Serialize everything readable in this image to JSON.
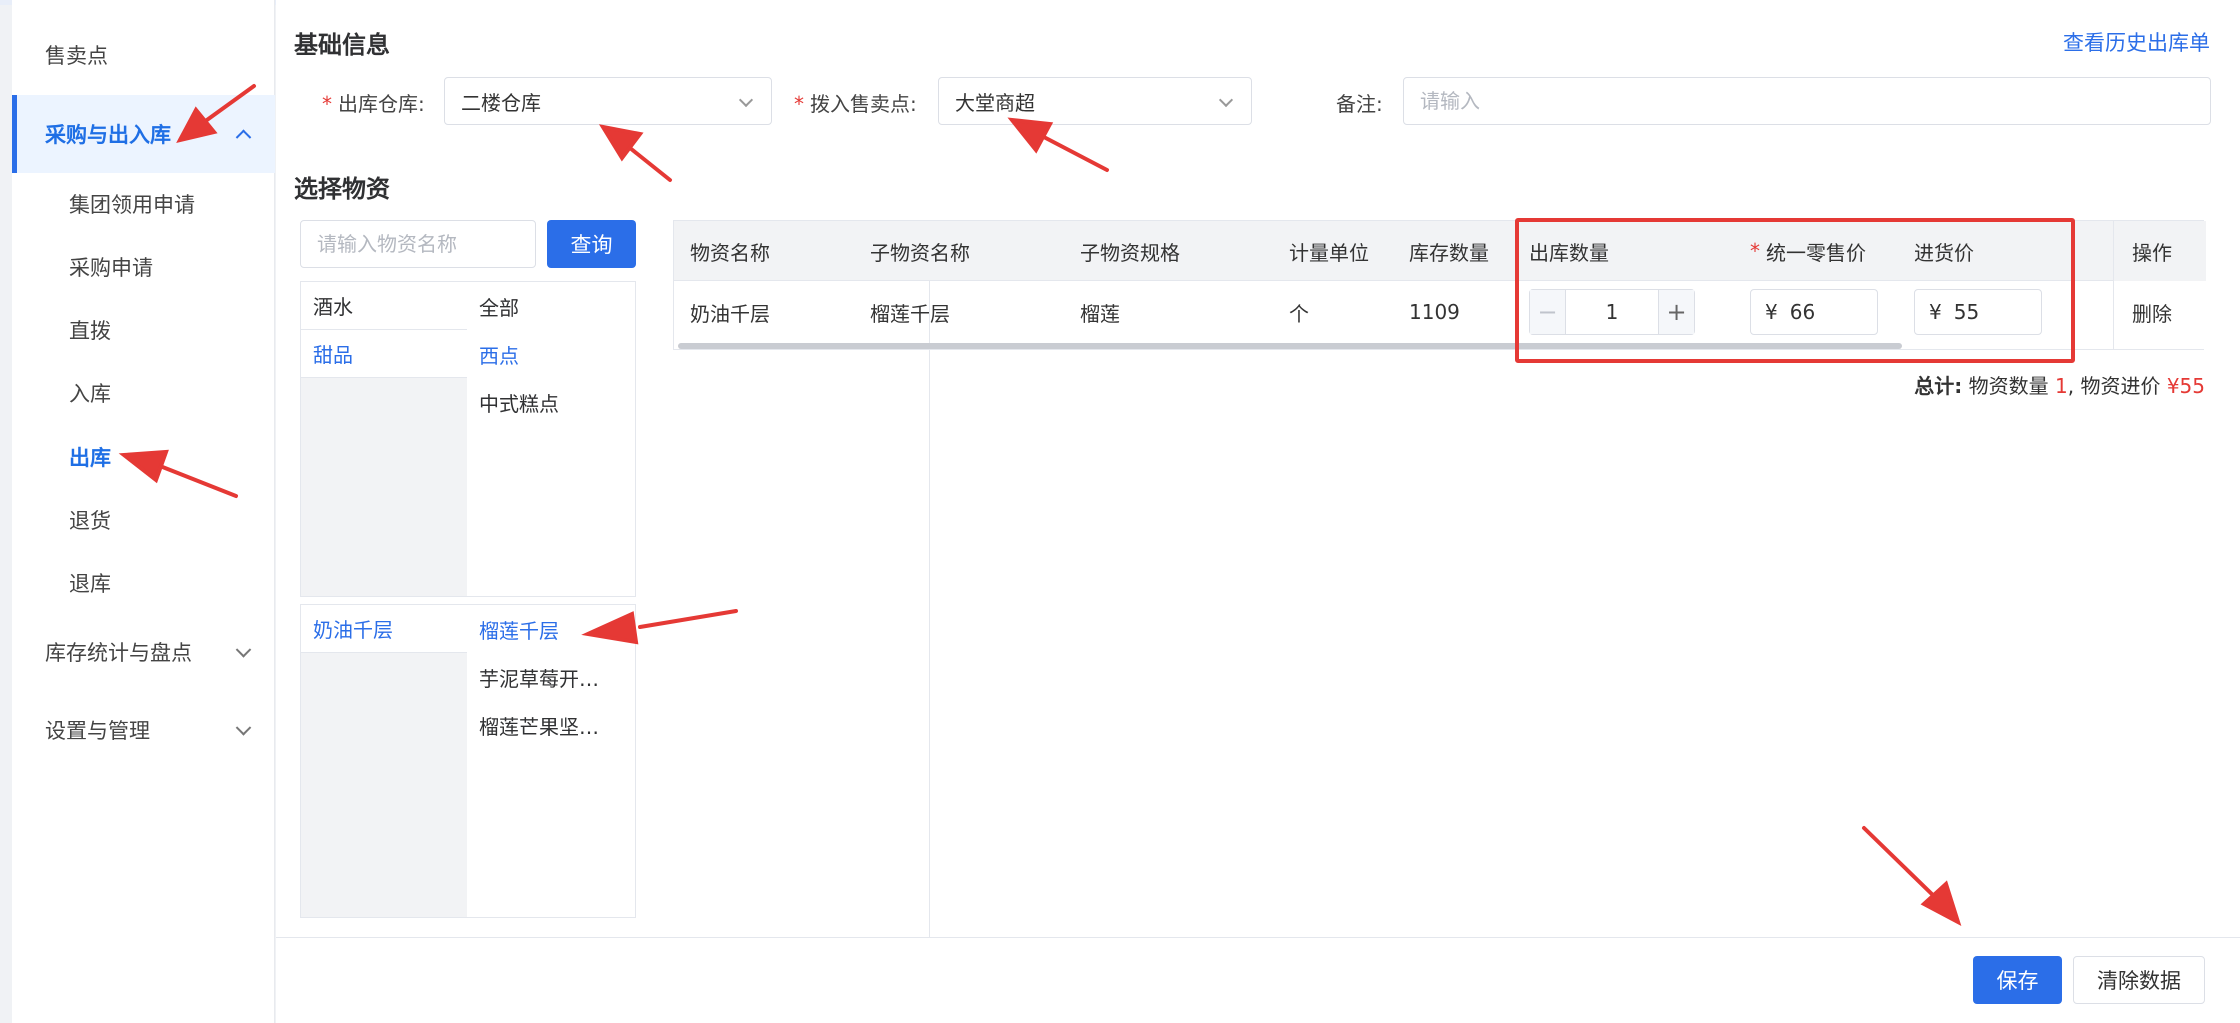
{
  "sidebar": {
    "top_item": "售卖点",
    "groups": [
      {
        "label": "采购与出入库",
        "expanded": true
      },
      {
        "label": "库存统计与盘点",
        "expanded": false
      },
      {
        "label": "设置与管理",
        "expanded": false
      }
    ],
    "sub_items": [
      "集团领用申请",
      "采购申请",
      "直拨",
      "入库",
      "出库",
      "退货",
      "退库"
    ],
    "active_sub": "出库"
  },
  "basic": {
    "title": "基础信息",
    "history_link": "查看历史出库单",
    "warehouse_label": "出库仓库:",
    "warehouse_value": "二楼仓库",
    "outlet_label": "拨入售卖点:",
    "outlet_value": "大堂商超",
    "remark_label": "备注:",
    "remark_placeholder": "请输入"
  },
  "select_material": {
    "title": "选择物资",
    "search_placeholder": "请输入物资名称",
    "search_button": "查询",
    "categories_left": [
      "酒水",
      "甜品"
    ],
    "categories_right": [
      "全部",
      "西点",
      "中式糕点"
    ],
    "items_left": [
      "奶油千层"
    ],
    "items_right": [
      "榴莲千层",
      "芋泥草莓开…",
      "榴莲芒果坚…"
    ]
  },
  "table": {
    "headers": [
      "物资名称",
      "子物资名称",
      "子物资规格",
      "计量单位",
      "库存数量",
      "出库数量",
      "统一零售价",
      "进货价",
      "操作"
    ],
    "row": {
      "name": "奶油千层",
      "sub_name": "榴莲千层",
      "spec": "榴莲",
      "unit": "个",
      "stock": "1109",
      "quantity": "1",
      "currency": "¥",
      "retail_price": "66",
      "purchase_price": "55",
      "action": "删除"
    },
    "minus": "−",
    "plus": "+"
  },
  "total": {
    "label": "总计:",
    "qty_label": "物资数量",
    "qty_value": "1",
    "sep": ",",
    "price_label": "物资进价",
    "price_value": "¥55"
  },
  "footer": {
    "save": "保存",
    "clear": "清除数据"
  },
  "colors": {
    "accent": "#2b6ee8",
    "annotation": "#e53935"
  }
}
